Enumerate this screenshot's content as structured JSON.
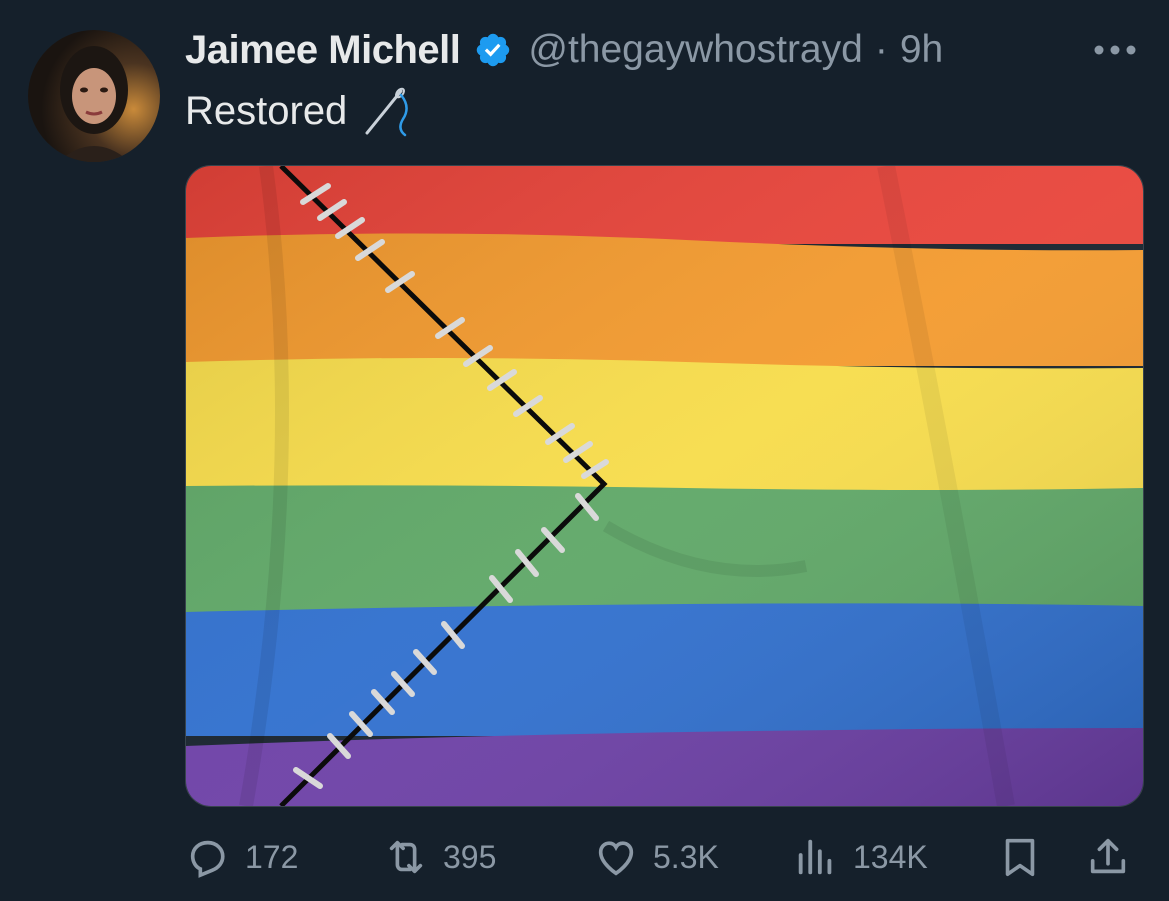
{
  "author": {
    "name": "Jaimee Michell",
    "handle": "@thegaywhostrayd",
    "separator": "·",
    "time": "9h",
    "verified": true
  },
  "tweet": {
    "text": "Restored",
    "emoji": "needle-emoji"
  },
  "media": {
    "description_icon": "rainbow-flag-stitched",
    "stripe_colors": [
      "#e8443a",
      "#f39a2e",
      "#f7dc4a",
      "#5ea766",
      "#2f6fce",
      "#6c3fa6"
    ]
  },
  "actions": {
    "replies": "172",
    "retweets": "395",
    "likes": "5.3K",
    "views": "134K"
  },
  "colors": {
    "background": "#15202b",
    "text": "#e7e9ea",
    "muted": "#8b98a5",
    "verified_blue": "#1d9bf0"
  }
}
